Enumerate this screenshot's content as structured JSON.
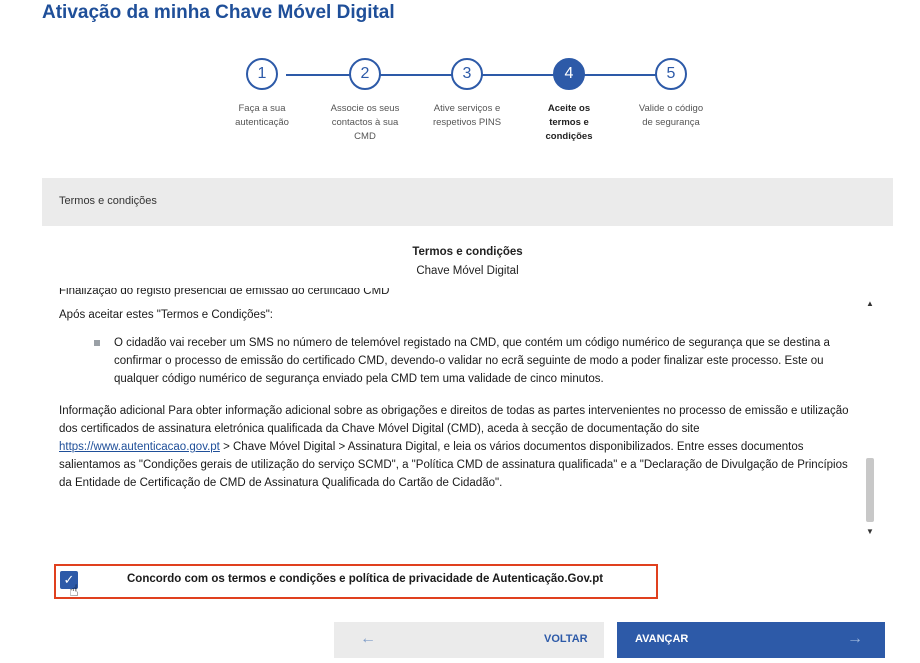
{
  "page": {
    "title": "Ativação da minha Chave Móvel Digital"
  },
  "stepper": {
    "steps": [
      {
        "number": "1",
        "label": "Faça a sua autenticação"
      },
      {
        "number": "2",
        "label": "Associe os seus contactos à sua CMD"
      },
      {
        "number": "3",
        "label": "Ative serviços e respetivos PINS"
      },
      {
        "number": "4",
        "label": "Aceite os termos e condições"
      },
      {
        "number": "5",
        "label": "Valide o código de segurança"
      }
    ],
    "active_step": 4
  },
  "section": {
    "header": "Termos e condições"
  },
  "terms": {
    "title": "Termos e condições",
    "subtitle": "Chave Móvel Digital",
    "cut_line": "Finalização do registo presencial de emissão do certificado CMD",
    "intro": "Após aceitar estes \"Termos e Condições\":",
    "bullet": "O cidadão vai receber um SMS no número de telemóvel registado na CMD, que contém um código numérico de segurança que se destina a confirmar o processo de emissão do certificado CMD, devendo-o validar no ecrã seguinte de modo a poder finalizar este processo. Este ou qualquer código numérico de segurança enviado pela CMD tem uma validade de cinco minutos.",
    "info_before_link": "Informação adicional Para obter informação adicional sobre as obrigações e direitos de todas as partes intervenientes no processo de emissão e utilização dos certificados de assinatura eletrónica qualificada da Chave Móvel Digital (CMD), aceda à secção de documentação do site ",
    "link": "https://www.autenticacao.gov.pt",
    "info_after_link": " > Chave Móvel Digital > Assinatura Digital, e leia os vários documentos disponibilizados. Entre esses documentos salientamos as \"Condições gerais de utilização do serviço SCMD\", a \"Política CMD de assinatura qualificada\" e a \"Declaração de Divulgação de Princípios da Entidade de Certificação de CMD de Assinatura Qualificada do Cartão de Cidadão\".",
    "scroll_fraction": 0.78
  },
  "consent": {
    "checked": true,
    "label": "Concordo com os termos e condições e política de privacidade de  Autenticação.Gov.pt",
    "highlight_color": "#e0401e"
  },
  "buttons": {
    "back_label": "VOLTAR",
    "next_label": "AVANÇAR"
  },
  "colors": {
    "primary": "#2d5aa8",
    "title": "#1f4f99",
    "panel": "#ebebeb"
  },
  "icons": {
    "checkbox": "check-icon",
    "cursor": "hand-pointer-icon",
    "back": "arrow-left-icon",
    "next": "arrow-right-icon",
    "scroll_up": "caret-up-icon",
    "scroll_down": "caret-down-icon"
  }
}
